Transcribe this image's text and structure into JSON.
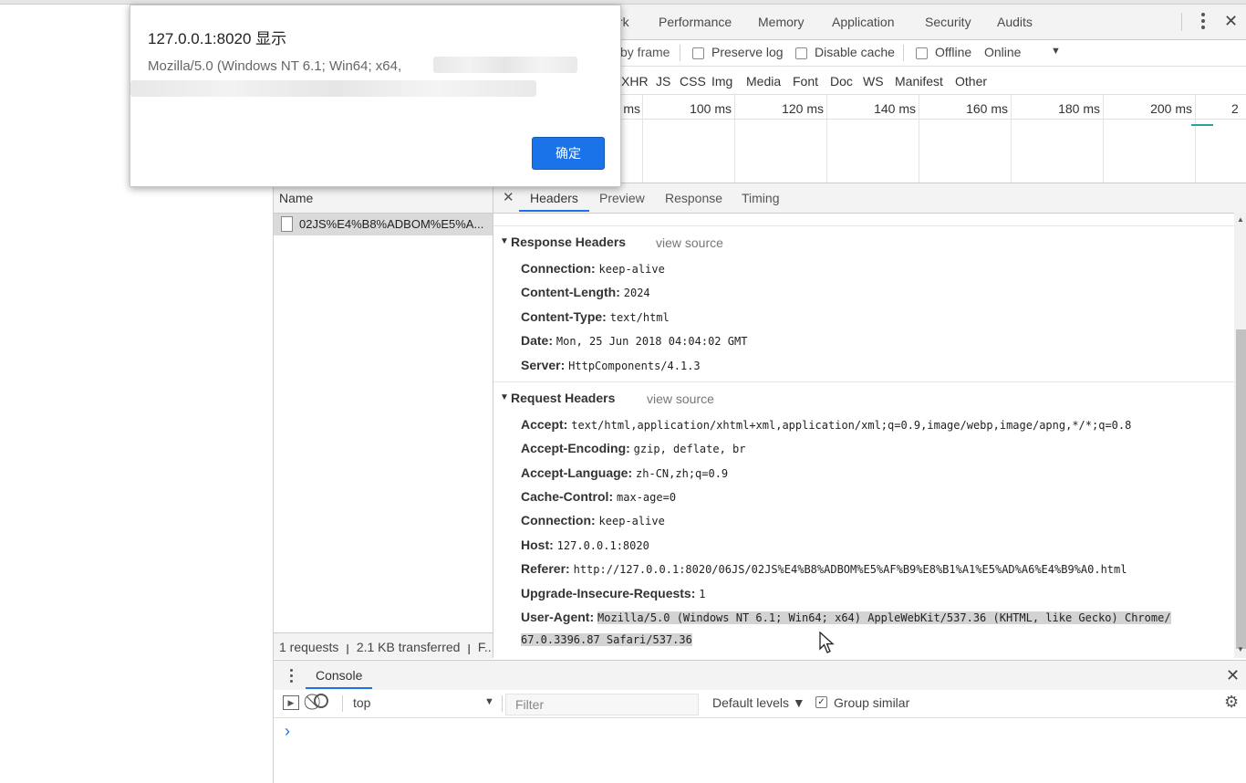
{
  "tabs": [
    "rk",
    "Performance",
    "Memory",
    "Application",
    "Security",
    "Audits"
  ],
  "toolbar": {
    "group_by_frame": "by frame",
    "preserve_log": "Preserve log",
    "disable_cache": "Disable cache",
    "offline": "Offline",
    "throttle": "Online",
    "dropdown_glyph": "▼"
  },
  "filters": [
    "XHR",
    "JS",
    "CSS",
    "Img",
    "Media",
    "Font",
    "Doc",
    "WS",
    "Manifest",
    "Other"
  ],
  "timeline_ticks": [
    "ms",
    "100 ms",
    "120 ms",
    "140 ms",
    "160 ms",
    "180 ms",
    "200 ms",
    "2"
  ],
  "requests": {
    "header": "Name",
    "items": [
      "02JS%E4%B8%ADBOM%E5%A..."
    ],
    "status": "1 requests  ꞁ  2.1 KB transferred  ꞁ  F..."
  },
  "detail_tabs": [
    "Headers",
    "Preview",
    "Response",
    "Timing"
  ],
  "response_headers": {
    "title": "Response Headers",
    "view_source": "view source",
    "rows": [
      {
        "k": "Connection:",
        "v": "keep-alive"
      },
      {
        "k": "Content-Length:",
        "v": "2024"
      },
      {
        "k": "Content-Type:",
        "v": "text/html"
      },
      {
        "k": "Date:",
        "v": "Mon, 25 Jun 2018 04:04:02 GMT"
      },
      {
        "k": "Server:",
        "v": "HttpComponents/4.1.3"
      }
    ]
  },
  "request_headers": {
    "title": "Request Headers",
    "view_source": "view source",
    "rows": [
      {
        "k": "Accept:",
        "v": "text/html,application/xhtml+xml,application/xml;q=0.9,image/webp,image/apng,*/*;q=0.8"
      },
      {
        "k": "Accept-Encoding:",
        "v": "gzip, deflate, br"
      },
      {
        "k": "Accept-Language:",
        "v": "zh-CN,zh;q=0.9"
      },
      {
        "k": "Cache-Control:",
        "v": "max-age=0"
      },
      {
        "k": "Connection:",
        "v": "keep-alive"
      },
      {
        "k": "Host:",
        "v": "127.0.0.1:8020"
      },
      {
        "k": "Referer:",
        "v": "http://127.0.0.1:8020/06JS/02JS%E4%B8%ADBOM%E5%AF%B9%E8%B1%A1%E5%AD%A6%E4%B9%A0.html"
      },
      {
        "k": "Upgrade-Insecure-Requests:",
        "v": "1"
      }
    ],
    "user_agent_key": "User-Agent:",
    "user_agent_line1": "Mozilla/5.0 (Windows NT 6.1; Win64; x64) AppleWebKit/537.36 (KHTML, like Gecko) Chrome/",
    "user_agent_line2": "67.0.3396.87 Safari/537.36"
  },
  "drawer": {
    "tab": "Console",
    "context": "top",
    "filter_placeholder": "Filter",
    "levels": "Default levels ▼",
    "group_similar": "Group similar",
    "prompt": "›"
  },
  "dialog": {
    "title": "127.0.0.1:8020 显示",
    "message": "Mozilla/5.0 (Windows NT 6.1; Win64; x64,",
    "ok": "确定"
  },
  "colors": {
    "accent": "#1a73e8",
    "selected_row": "#dadada",
    "panel_bg": "#f3f3f3"
  }
}
